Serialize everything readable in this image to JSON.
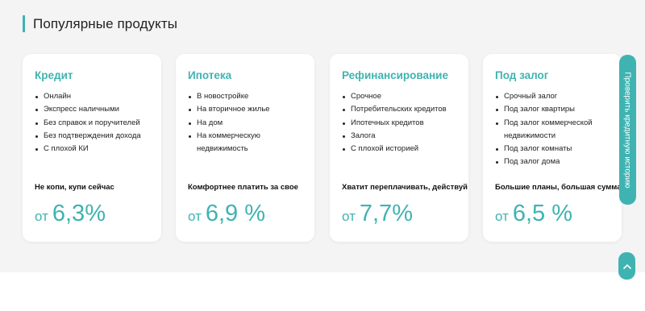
{
  "section": {
    "title": "Популярные продукты"
  },
  "cards": [
    {
      "title": "Кредит",
      "items": [
        "Онлайн",
        "Экспресс наличными",
        "Без справок и поручителей",
        "Без подтверждения дохода",
        "С плохой КИ"
      ],
      "tagline": "Не копи, купи сейчас",
      "rate_prefix": "от",
      "rate_value": "6,3%"
    },
    {
      "title": "Ипотека",
      "items": [
        "В новостройке",
        "На вторичное жилье",
        "На дом",
        "На коммерческую",
        "недвижимость"
      ],
      "tagline": "Комфортнее платить за свое",
      "rate_prefix": "от",
      "rate_value": "6,9 %"
    },
    {
      "title": "Рефинансирование",
      "items": [
        "Срочное",
        "Потребительских кредитов",
        "Ипотечных кредитов",
        "Залога",
        "С плохой историей"
      ],
      "tagline": "Хватит переплачивать, действуй",
      "rate_prefix": "от",
      "rate_value": "7,7%"
    },
    {
      "title": "Под залог",
      "items": [
        "Срочный залог",
        "Под залог квартиры",
        "Под залог коммерческой",
        "недвижимости",
        "Под залог комнаты",
        "Под залог дома"
      ],
      "tagline": "Большие планы, большая сумма",
      "rate_prefix": "от",
      "rate_value": "6,5 %"
    }
  ],
  "side_tab": {
    "label": "Проверить кредитную историю"
  },
  "colors": {
    "accent": "#3fb3b1",
    "background": "#f4f4f4",
    "card": "#ffffff"
  },
  "icons": {
    "scroll_top": "chevron-up-icon"
  }
}
